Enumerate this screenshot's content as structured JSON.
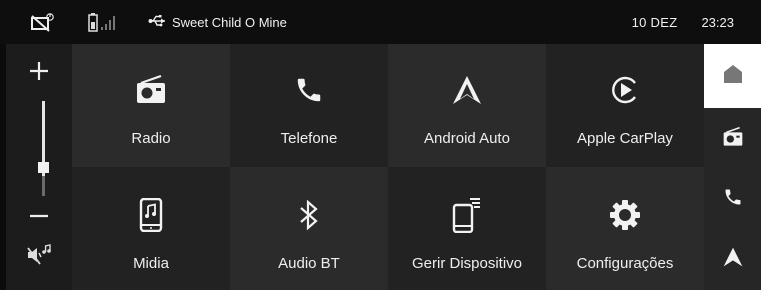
{
  "status_bar": {
    "icons": [
      "phone-no-signal-icon",
      "battery-icon",
      "signal-bars-icon",
      "usb-icon"
    ],
    "media_title": "Sweet Child O Mine",
    "date": "10 DEZ",
    "time": "23:23"
  },
  "volume": {
    "icons": [
      "volume-up-plus-icon",
      "volume-down-minus-icon",
      "mute-music-icon"
    ],
    "level": 0.22
  },
  "apps": [
    {
      "label": "Radio",
      "icon": "radio-icon"
    },
    {
      "label": "Telefone",
      "icon": "phone-icon"
    },
    {
      "label": "Android Auto",
      "icon": "android-auto-icon"
    },
    {
      "label": "Apple CarPlay",
      "icon": "carplay-icon"
    },
    {
      "label": "Midia",
      "icon": "media-icon"
    },
    {
      "label": "Audio BT",
      "icon": "bluetooth-icon"
    },
    {
      "label": "Gerir Dispositivo",
      "icon": "manage-device-icon"
    },
    {
      "label": "Configurações",
      "icon": "gear-icon"
    }
  ],
  "side_rail": {
    "items": [
      "home-icon",
      "radio-icon",
      "phone-icon",
      "android-auto-icon"
    ],
    "active": "home-icon"
  },
  "colors": {
    "background": "#0b0b0b",
    "tile_dark": "#222222",
    "tile_light": "#2b2b2b",
    "rail": "#262626",
    "rail_active": "#ffffff"
  }
}
